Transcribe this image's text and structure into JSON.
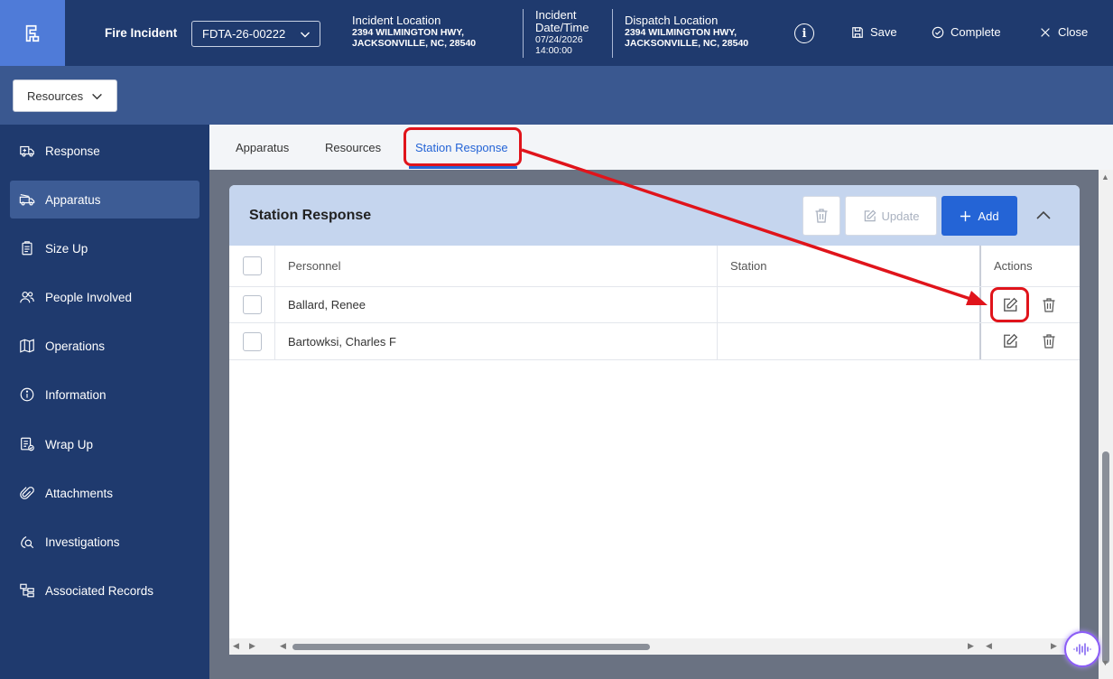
{
  "header": {
    "incident_type": "Fire Incident",
    "incident_id": "FDTA-26-00222",
    "incident_location": {
      "title": "Incident Location",
      "line1": "2394 WILMINGTON HWY,",
      "line2": "JACKSONVILLE, NC, 28540"
    },
    "incident_datetime": {
      "title1": "Incident",
      "title2": "Date/Time",
      "date": "07/24/2026",
      "time": "14:00:00"
    },
    "dispatch_location": {
      "title": "Dispatch Location",
      "line1": "2394 WILMINGTON HWY,",
      "line2": "JACKSONVILLE, NC, 28540"
    },
    "info_icon": "i",
    "save_label": "Save",
    "complete_label": "Complete",
    "close_label": "Close"
  },
  "subbar": {
    "dropdown_label": "Resources"
  },
  "sidebar": {
    "items": [
      {
        "label": "Response",
        "icon": "ambulance-icon"
      },
      {
        "label": "Apparatus",
        "icon": "fire-truck-icon"
      },
      {
        "label": "Size Up",
        "icon": "clipboard-icon"
      },
      {
        "label": "People Involved",
        "icon": "people-icon"
      },
      {
        "label": "Operations",
        "icon": "map-icon"
      },
      {
        "label": "Information",
        "icon": "info-icon"
      },
      {
        "label": "Wrap Up",
        "icon": "checklist-icon"
      },
      {
        "label": "Attachments",
        "icon": "paperclip-icon"
      },
      {
        "label": "Investigations",
        "icon": "magnify-icon"
      },
      {
        "label": "Associated Records",
        "icon": "hierarchy-icon"
      }
    ],
    "active": "Apparatus"
  },
  "tabs": {
    "items": [
      "Apparatus",
      "Resources",
      "Station Response"
    ],
    "active": "Station Response"
  },
  "panel": {
    "title": "Station Response",
    "update_label": "Update",
    "add_label": "Add",
    "columns": [
      "Personnel",
      "Station",
      "Actions"
    ],
    "rows": [
      {
        "personnel": "Ballard, Renee",
        "station": ""
      },
      {
        "personnel": "Bartowksi, Charles F",
        "station": ""
      }
    ]
  },
  "colors": {
    "header_bg": "#1f3a6e",
    "subbar_bg": "#3a5890",
    "accent": "#2464d6",
    "panel_head": "#c5d5ee",
    "annotation": "#e0141b"
  }
}
